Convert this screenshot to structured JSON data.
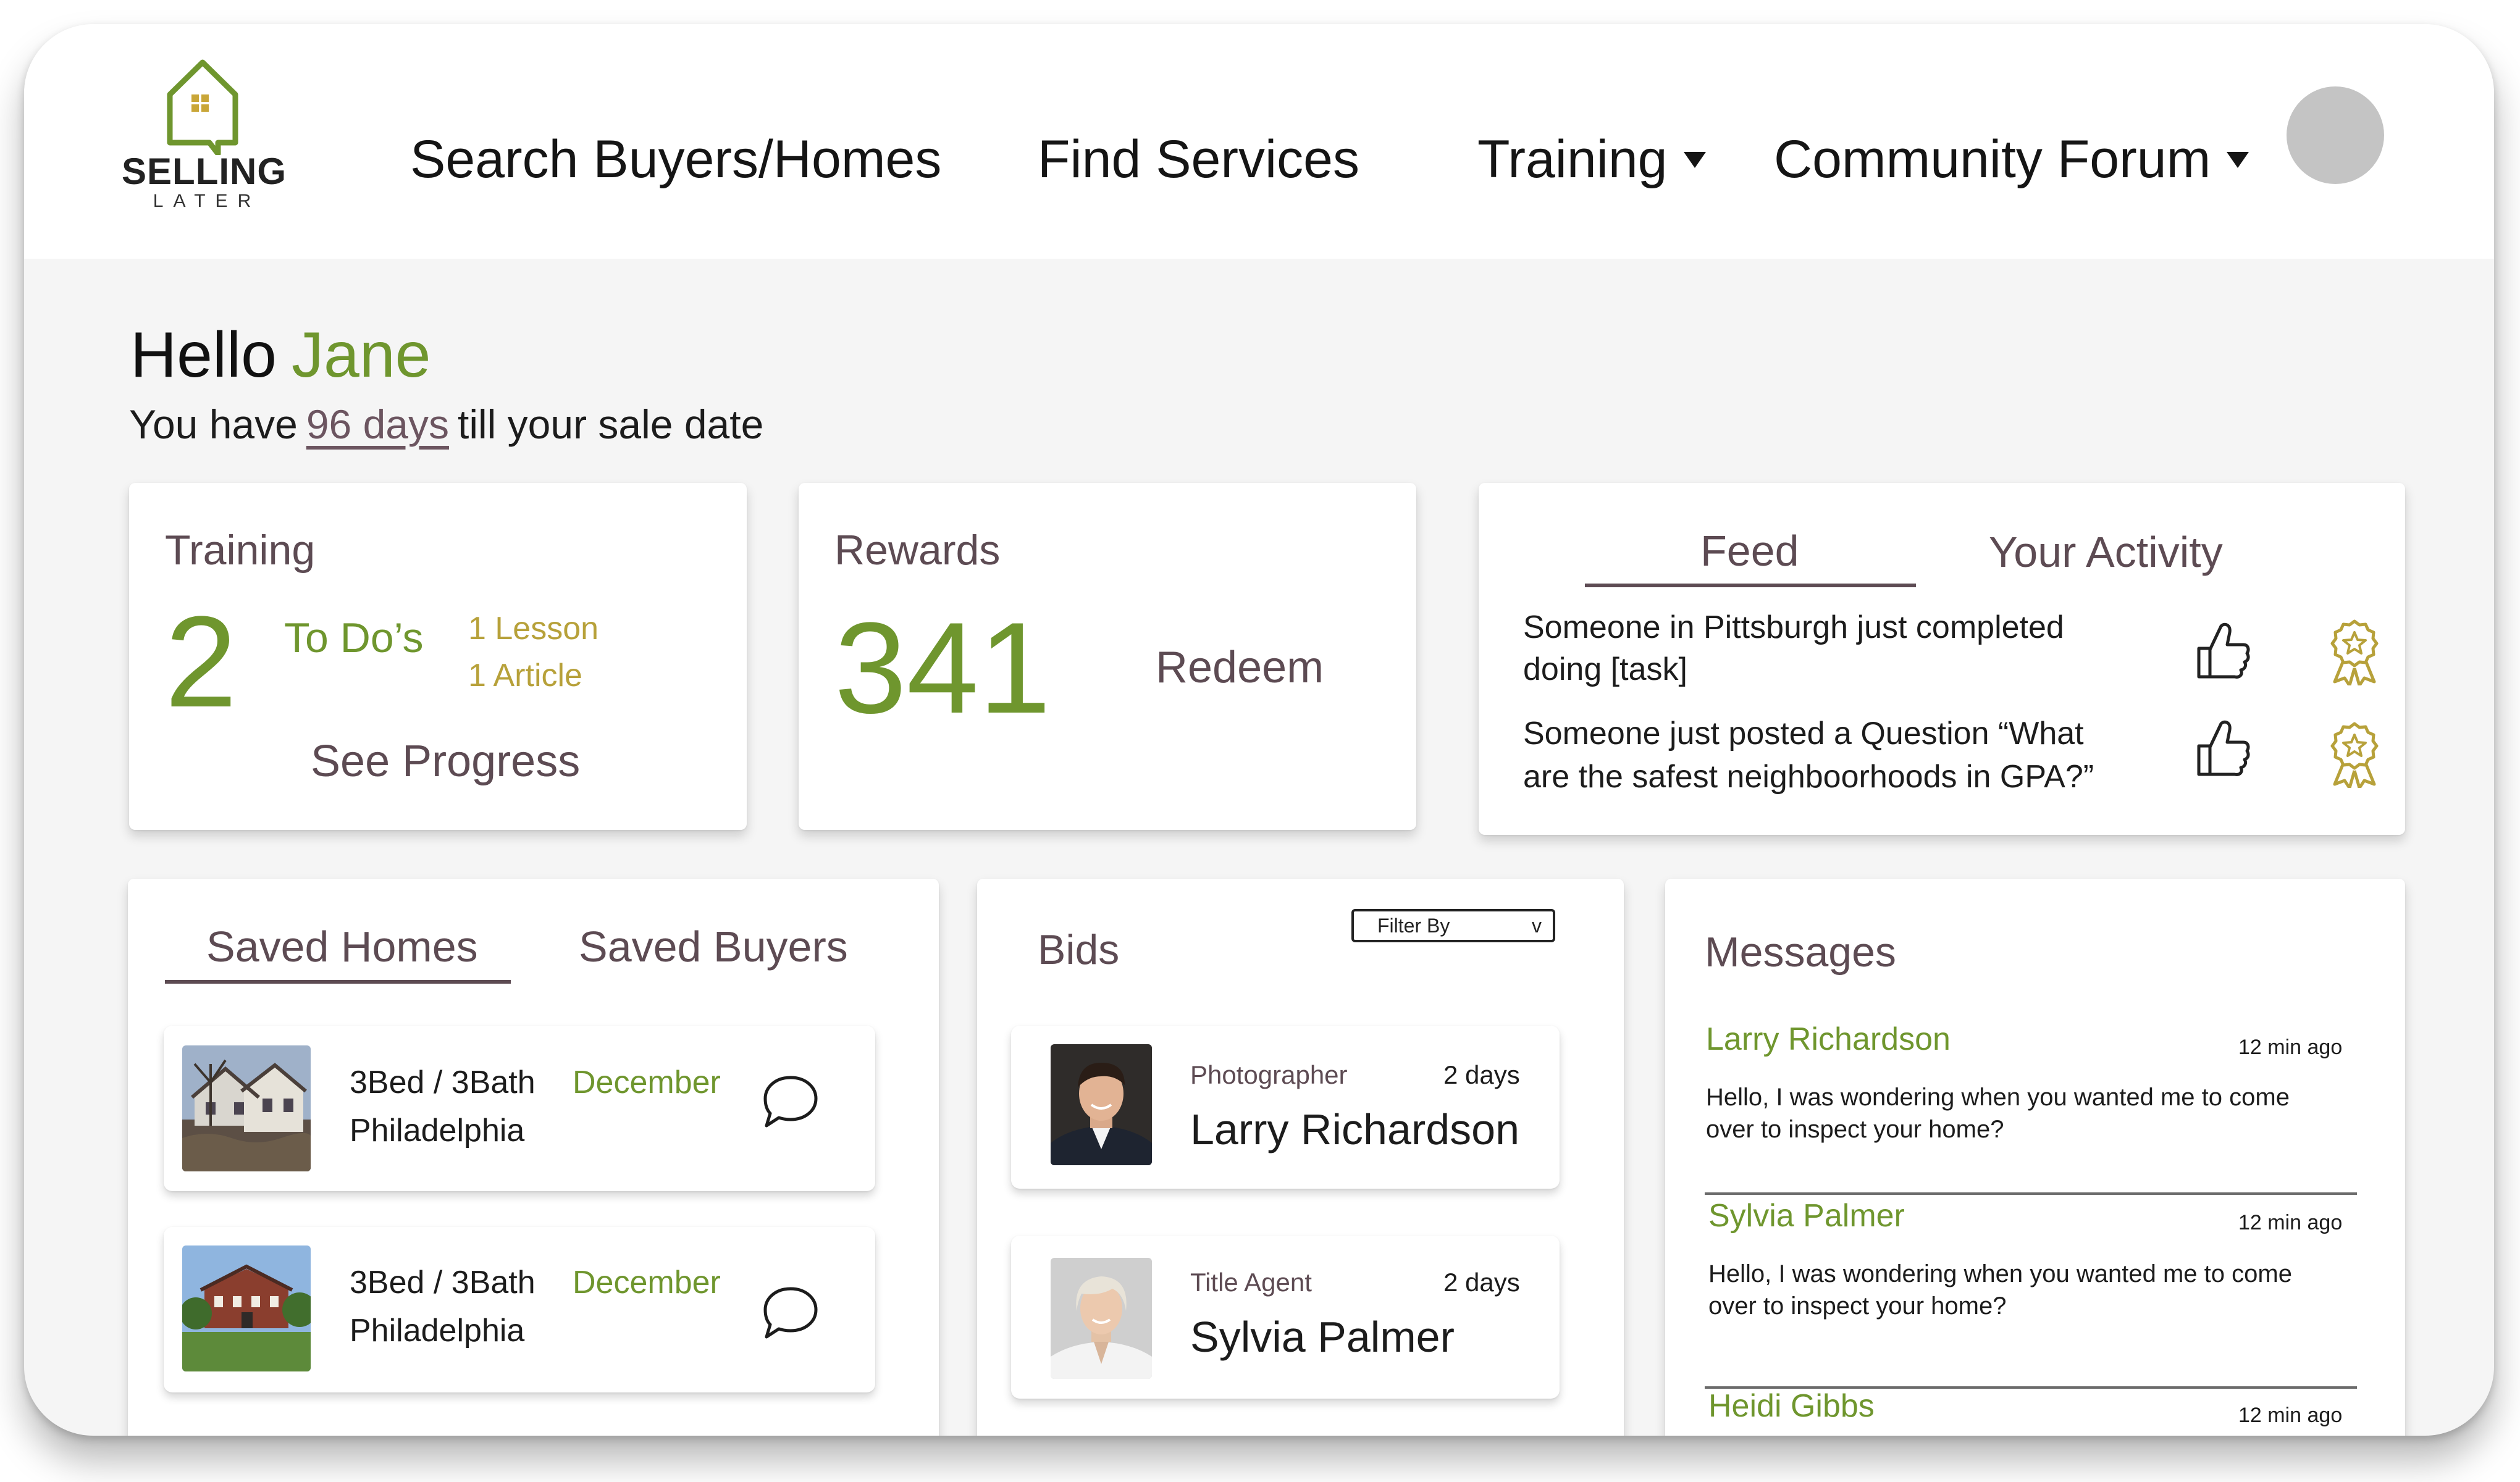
{
  "brand": {
    "name": "SELLING",
    "tagline": "LATER",
    "accent_color": "#6f962e",
    "text_color": "#5d4b53",
    "gold_color": "#b7a13a"
  },
  "nav": {
    "search": "Search Buyers/Homes",
    "services": "Find Services",
    "training": "Training",
    "forum": "Community Forum"
  },
  "greeting": {
    "hello": "Hello",
    "name": "Jane",
    "prefix": "You have",
    "days": "96 days",
    "suffix": "till your sale date"
  },
  "training_card": {
    "title": "Training",
    "count": "2",
    "todos_label": "To Do’s",
    "lesson": "1 Lesson",
    "article": "1 Article",
    "progress_link": "See Progress"
  },
  "rewards_card": {
    "title": "Rewards",
    "points": "341",
    "redeem": "Redeem"
  },
  "feed_card": {
    "tabs": [
      "Feed",
      "Your Activity"
    ],
    "items": [
      {
        "text_line1": "Someone in Pittsburgh just completed",
        "text_line2": "doing [task]",
        "like_icon": "thumbs-up-icon",
        "award_icon": "award-badge-icon"
      },
      {
        "text_line1": "Someone just posted a Question “What",
        "text_line2": "are the safest neighboorhoods in GPA?”",
        "like_icon": "thumbs-up-icon",
        "award_icon": "award-badge-icon"
      }
    ]
  },
  "saved_card": {
    "tabs": [
      "Saved Homes",
      "Saved Buyers"
    ],
    "homes": [
      {
        "beds_baths": "3Bed / 3Bath",
        "city": "Philadelphia",
        "month": "December",
        "icon": "chat-bubble-icon"
      },
      {
        "beds_baths": "3Bed / 3Bath",
        "city": "Philadelphia",
        "month": "December",
        "icon": "chat-bubble-icon"
      }
    ]
  },
  "bids_card": {
    "title": "Bids",
    "filter_label": "Filter By",
    "filter_caret": "v",
    "bids": [
      {
        "role": "Photographer",
        "time": "2 days",
        "name": "Larry Richardson"
      },
      {
        "role": "Title Agent",
        "time": "2 days",
        "name": "Sylvia Palmer"
      }
    ]
  },
  "messages_card": {
    "title": "Messages",
    "messages": [
      {
        "name": "Larry Richardson",
        "time": "12 min ago",
        "line1": "Hello, I was wondering when you wanted me  to come",
        "line2": "over to inspect your home?"
      },
      {
        "name": "Sylvia Palmer",
        "time": "12 min ago",
        "line1": "Hello, I was wondering when you wanted me  to come",
        "line2": "over to inspect your home?"
      },
      {
        "name": "Heidi Gibbs",
        "time": "12 min ago"
      }
    ]
  }
}
